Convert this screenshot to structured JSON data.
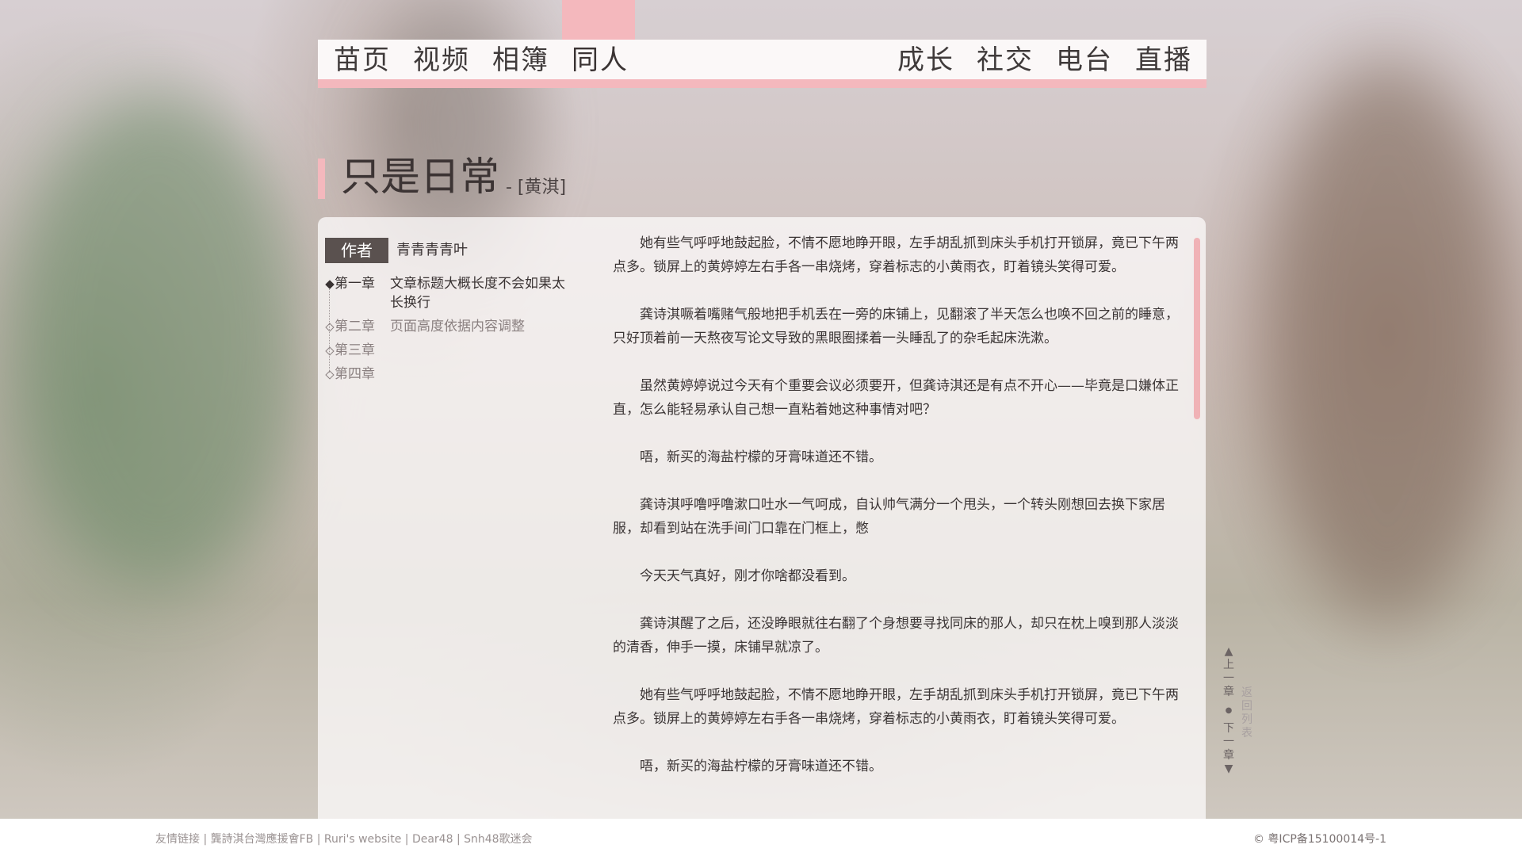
{
  "nav": {
    "left": [
      "苗页",
      "视频",
      "相簿",
      "同人"
    ],
    "right": [
      "成长",
      "社交",
      "电台",
      "直播"
    ],
    "active": "同人"
  },
  "title": {
    "main": "只是日常",
    "author_suffix": "- [黄淇]"
  },
  "sidebar": {
    "author_label": "作者",
    "author_name": "青青青青叶",
    "chapters": [
      {
        "num": "第一章",
        "name": "文章标题大概长度不会如果太长换行",
        "current": true
      },
      {
        "num": "第二章",
        "name": "页面高度依据内容调整",
        "current": false
      },
      {
        "num": "第三章",
        "name": "",
        "current": false
      },
      {
        "num": "第四章",
        "name": "",
        "current": false
      }
    ]
  },
  "article": {
    "paragraphs": [
      "她有些气呼呼地鼓起脸，不情不愿地睁开眼，左手胡乱抓到床头手机打开锁屏，竟已下午两点多。锁屏上的黄婷婷左右手各一串烧烤，穿着标志的小黄雨衣，盯着镜头笑得可爱。",
      "龚诗淇噘着嘴赌气般地把手机丢在一旁的床铺上，见翻滚了半天怎么也唤不回之前的睡意，只好顶着前一天熬夜写论文导致的黑眼圈揉着一头睡乱了的杂毛起床洗漱。",
      "虽然黄婷婷说过今天有个重要会议必须要开，但龚诗淇还是有点不开心——毕竟是口嫌体正直，怎么能轻易承认自己想一直粘着她这种事情对吧？",
      "唔，新买的海盐柠檬的牙膏味道还不错。",
      "龚诗淇呼噜呼噜漱口吐水一气呵成，自认帅气满分一个甩头，一个转头刚想回去换下家居服，却看到站在洗手间门口靠在门框上，憋",
      "今天天气真好，刚才你啥都没看到。",
      "龚诗淇醒了之后，还没睁眼就往右翻了个身想要寻找同床的那人，却只在枕上嗅到那人淡淡的清香，伸手一摸，床铺早就凉了。",
      "她有些气呼呼地鼓起脸，不情不愿地睁开眼，左手胡乱抓到床头手机打开锁屏，竟已下午两点多。锁屏上的黄婷婷左右手各一串烧烤，穿着标志的小黄雨衣，盯着镜头笑得可爱。",
      "唔，新买的海盐柠檬的牙膏味道还不错。"
    ]
  },
  "side_nav": {
    "prev": "▲上一章",
    "dot": "●",
    "next": "下一章▼",
    "back": "返回列表"
  },
  "footer": {
    "links": "友情链接 | 龔詩淇台灣應援會FB | Ruri's website | Dear48 | Snh48歌迷会",
    "copyright": "© 粤ICP备15100014号-1"
  },
  "colors": {
    "accent_pink": "#f4b8bd",
    "author_tag_bg": "#5a514f"
  }
}
